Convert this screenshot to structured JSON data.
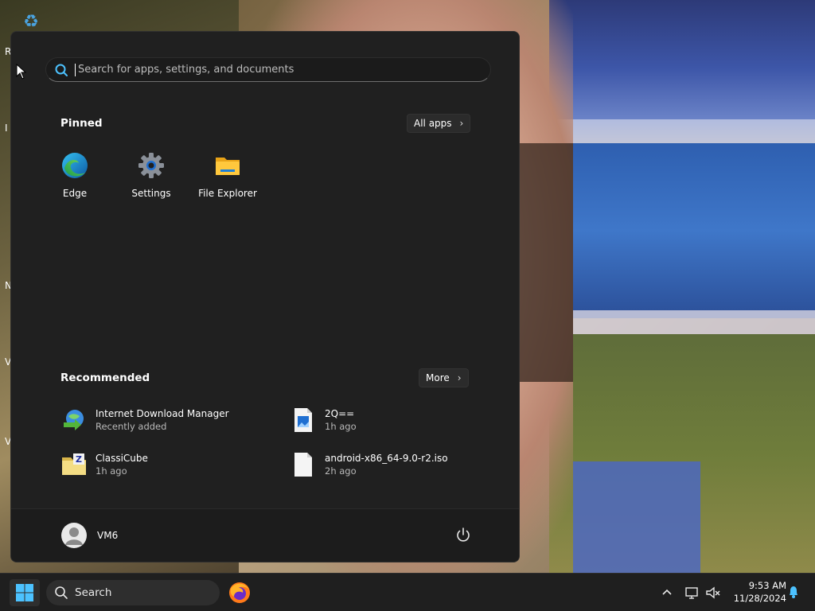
{
  "desktop": {
    "icon_names": [
      "recycle-bin-icon"
    ],
    "edge_letters": [
      "R",
      "I",
      "N",
      "V",
      "V"
    ]
  },
  "start_menu": {
    "search": {
      "placeholder": "Search for apps, settings, and documents",
      "value": ""
    },
    "pinned": {
      "title": "Pinned",
      "all_apps_label": "All apps",
      "apps": [
        {
          "label": "Edge",
          "icon": "edge-icon"
        },
        {
          "label": "Settings",
          "icon": "settings-gear-icon"
        },
        {
          "label": "File Explorer",
          "icon": "folder-icon"
        }
      ]
    },
    "recommended": {
      "title": "Recommended",
      "more_label": "More",
      "items": [
        {
          "name": "Internet Download Manager",
          "sub": "Recently added",
          "icon": "idm-globe-icon"
        },
        {
          "name": "2Q==",
          "sub": "1h ago",
          "icon": "image-file-icon"
        },
        {
          "name": "ClassiCube",
          "sub": "1h ago",
          "icon": "zip-folder-icon"
        },
        {
          "name": "android-x86_64-9.0-r2.iso",
          "sub": "2h ago",
          "icon": "blank-file-icon"
        }
      ]
    },
    "footer": {
      "user_name": "VM6",
      "power_icon": "power-icon"
    }
  },
  "taskbar": {
    "search_label": "Search",
    "pinned": [
      "firefox-icon"
    ],
    "tray_icons": [
      "chevron-up-icon",
      "display-network-icon",
      "speaker-muted-icon"
    ],
    "clock": {
      "time": "9:53 AM",
      "date": "11/28/2024"
    },
    "notification_icon": "bell-icon"
  },
  "colors": {
    "menu_bg": "#202020",
    "accent": "#0078d4"
  }
}
